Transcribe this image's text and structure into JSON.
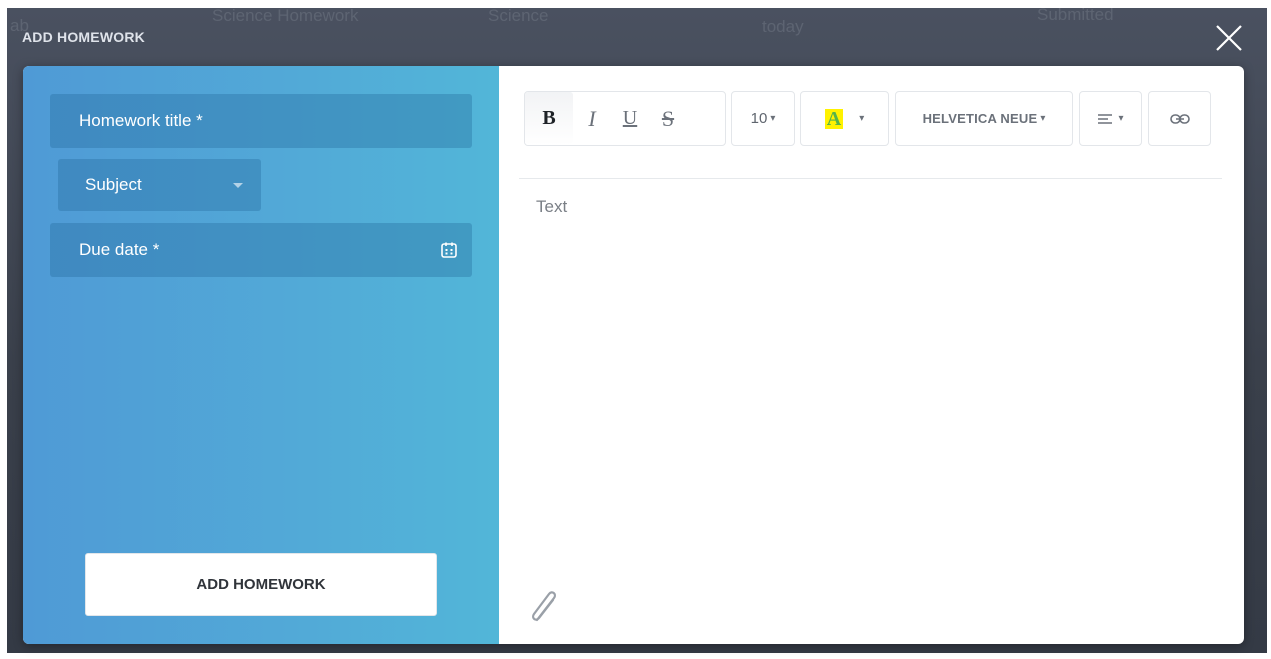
{
  "background_row": {
    "col1": "ab",
    "col2": "Science Homework",
    "col3": "Science",
    "col4": "today",
    "col5": "Submitted"
  },
  "modal": {
    "title": "ADD HOMEWORK",
    "close_icon": "close-icon"
  },
  "form": {
    "title_placeholder": "Homework title *",
    "subject_placeholder": "Subject",
    "due_date_placeholder": "Due date *",
    "submit_label": "ADD HOMEWORK"
  },
  "toolbar": {
    "bold": "B",
    "italic": "I",
    "underline": "U",
    "strike": "S",
    "font_size": "10",
    "highlight": "A",
    "font_family": "HELVETICA NEUE",
    "highlight_color": "#fff200"
  },
  "editor": {
    "placeholder": "Text"
  },
  "colors": {
    "panel_left": "#4f9ad6",
    "panel_right": "#52b6d8"
  }
}
